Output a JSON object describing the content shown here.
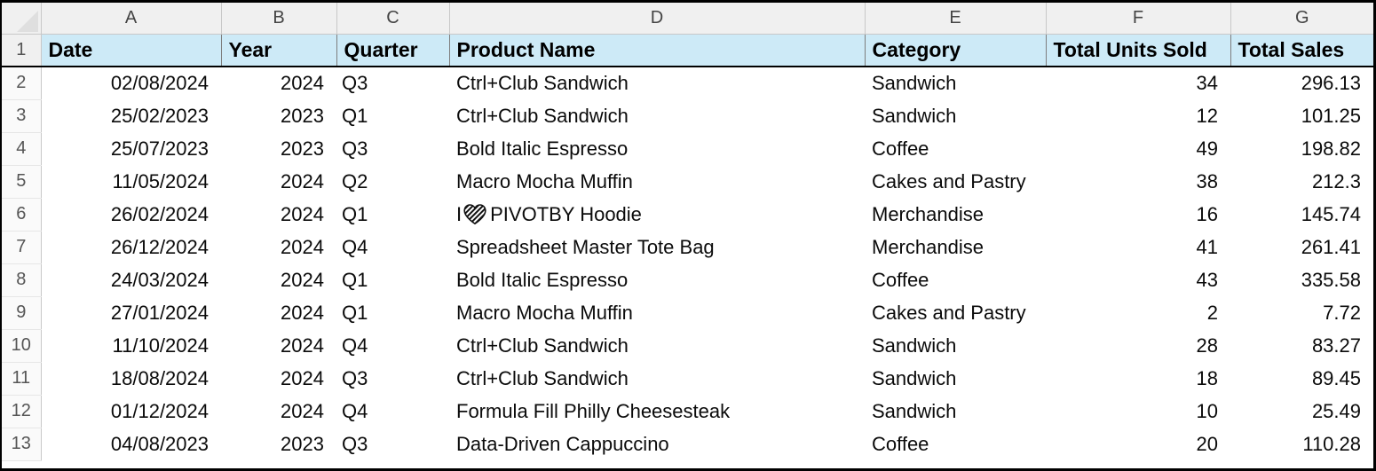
{
  "app": {
    "type": "spreadsheet",
    "select_all_label": "Select All"
  },
  "grid": {
    "column_letters": [
      "A",
      "B",
      "C",
      "D",
      "E",
      "F",
      "G"
    ],
    "row_numbers": [
      "1",
      "2",
      "3",
      "4",
      "5",
      "6",
      "7",
      "8",
      "9",
      "10",
      "11",
      "12",
      "13"
    ],
    "header_fill": "#CDEAF7",
    "column_header_fill": "#F0F0F0",
    "row_header_fill": "#FAFAFA",
    "grid_line": "#C8C8C8"
  },
  "table": {
    "headers": [
      "Date",
      "Year",
      "Quarter",
      "Product Name",
      "Category",
      "Total Units Sold",
      "Total Sales"
    ],
    "rows": [
      {
        "row": "2",
        "date": "02/08/2024",
        "year": "2024",
        "quarter": "Q3",
        "product": "Ctrl+Club Sandwich",
        "category": "Sandwich",
        "units": "34",
        "sales": "296.13"
      },
      {
        "row": "3",
        "date": "25/02/2023",
        "year": "2023",
        "quarter": "Q1",
        "product": "Ctrl+Club Sandwich",
        "category": "Sandwich",
        "units": "12",
        "sales": "101.25"
      },
      {
        "row": "4",
        "date": "25/07/2023",
        "year": "2023",
        "quarter": "Q3",
        "product": "Bold Italic Espresso",
        "category": "Coffee",
        "units": "49",
        "sales": "198.82"
      },
      {
        "row": "5",
        "date": "11/05/2024",
        "year": "2024",
        "quarter": "Q2",
        "product": "Macro Mocha Muffin",
        "category": "Cakes and Pastry",
        "units": "38",
        "sales": "212.3"
      },
      {
        "row": "6",
        "date": "26/02/2024",
        "year": "2024",
        "quarter": "Q1",
        "product_prefix": "I",
        "product_icon": "heart-emoji",
        "product_suffix": "PIVOTBY Hoodie",
        "product": "I ❤ PIVOTBY Hoodie",
        "category": "Merchandise",
        "units": "16",
        "sales": "145.74"
      },
      {
        "row": "7",
        "date": "26/12/2024",
        "year": "2024",
        "quarter": "Q4",
        "product": "Spreadsheet Master Tote Bag",
        "category": "Merchandise",
        "units": "41",
        "sales": "261.41"
      },
      {
        "row": "8",
        "date": "24/03/2024",
        "year": "2024",
        "quarter": "Q1",
        "product": "Bold Italic Espresso",
        "category": "Coffee",
        "units": "43",
        "sales": "335.58"
      },
      {
        "row": "9",
        "date": "27/01/2024",
        "year": "2024",
        "quarter": "Q1",
        "product": "Macro Mocha Muffin",
        "category": "Cakes and Pastry",
        "units": "2",
        "sales": "7.72"
      },
      {
        "row": "10",
        "date": "11/10/2024",
        "year": "2024",
        "quarter": "Q4",
        "product": "Ctrl+Club Sandwich",
        "category": "Sandwich",
        "units": "28",
        "sales": "83.27"
      },
      {
        "row": "11",
        "date": "18/08/2024",
        "year": "2024",
        "quarter": "Q3",
        "product": "Ctrl+Club Sandwich",
        "category": "Sandwich",
        "units": "18",
        "sales": "89.45"
      },
      {
        "row": "12",
        "date": "01/12/2024",
        "year": "2024",
        "quarter": "Q4",
        "product": "Formula Fill Philly Cheesesteak",
        "category": "Sandwich",
        "units": "10",
        "sales": "25.49"
      },
      {
        "row": "13",
        "date": "04/08/2023",
        "year": "2023",
        "quarter": "Q3",
        "product": "Data-Driven Cappuccino",
        "category": "Coffee",
        "units": "20",
        "sales": "110.28"
      }
    ]
  }
}
